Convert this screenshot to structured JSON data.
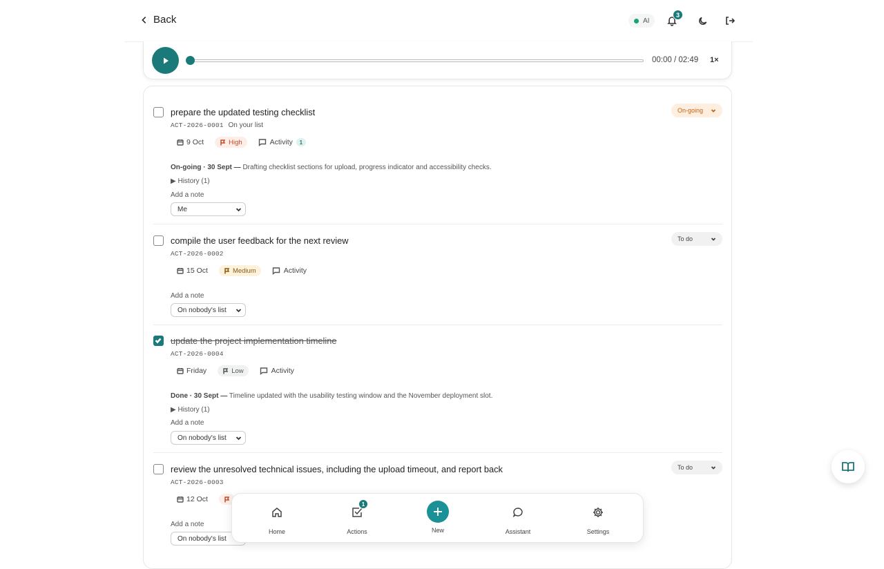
{
  "header": {
    "back_label": "Back",
    "ai_label": "AI",
    "notification_count": "3"
  },
  "player": {
    "time": "00:00 / 02:49",
    "speed": "1×",
    "progress": 0
  },
  "tasks": [
    {
      "title": "prepare the updated testing checklist",
      "id": "ACT-2026-0001",
      "assignee_text": "On your list",
      "checked": false,
      "status": "On-going",
      "date": "9 Oct",
      "priority": "High",
      "activity_label": "Activity",
      "activity_count": "1",
      "status_prefix": "On-going · 30 Sept —",
      "status_text": "Drafting checklist sections for upload, progress indicator and accessibility checks.",
      "history": "History (1)",
      "add_note": "Add a note",
      "owner": "Me"
    },
    {
      "title": "compile the user feedback for the next review",
      "id": "ACT-2026-0002",
      "assignee_text": "",
      "checked": false,
      "status": "To do",
      "date": "15 Oct",
      "priority": "Medium",
      "activity_label": "Activity",
      "add_note": "Add a note",
      "owner": "On nobody's list"
    },
    {
      "title": "update the project implementation timeline",
      "id": "ACT-2026-0004",
      "assignee_text": "",
      "checked": true,
      "date": "Friday",
      "priority": "Low",
      "activity_label": "Activity",
      "status_prefix": "Done · 30 Sept —",
      "status_text": "Timeline updated with the usability testing window and the November deployment slot.",
      "history": "History (1)",
      "add_note": "Add a note",
      "owner": "On nobody's list"
    },
    {
      "title": "review the unresolved technical issues, including the upload timeout, and report back",
      "id": "ACT-2026-0003",
      "assignee_text": "",
      "checked": false,
      "status": "To do",
      "date": "12 Oct",
      "add_note": "Add a note",
      "owner": "On nobody's list"
    }
  ],
  "nav": {
    "home": "Home",
    "actions": "Actions",
    "actions_badge": "1",
    "new": "New",
    "assistant": "Assistant",
    "settings": "Settings"
  },
  "colors": {
    "accent": "#1a7a7a",
    "high": "#c54a2a",
    "medium": "#8a5a10",
    "ongoing": "#c2620e"
  },
  "icons": [
    "chevron-left-icon",
    "bell-icon",
    "moon-icon",
    "logout-icon",
    "play-icon",
    "calendar-icon",
    "flag-icon",
    "comment-icon",
    "home-icon",
    "check-square-icon",
    "plus-icon",
    "chat-icon",
    "gear-icon",
    "book-icon",
    "chevron-down-icon"
  ]
}
